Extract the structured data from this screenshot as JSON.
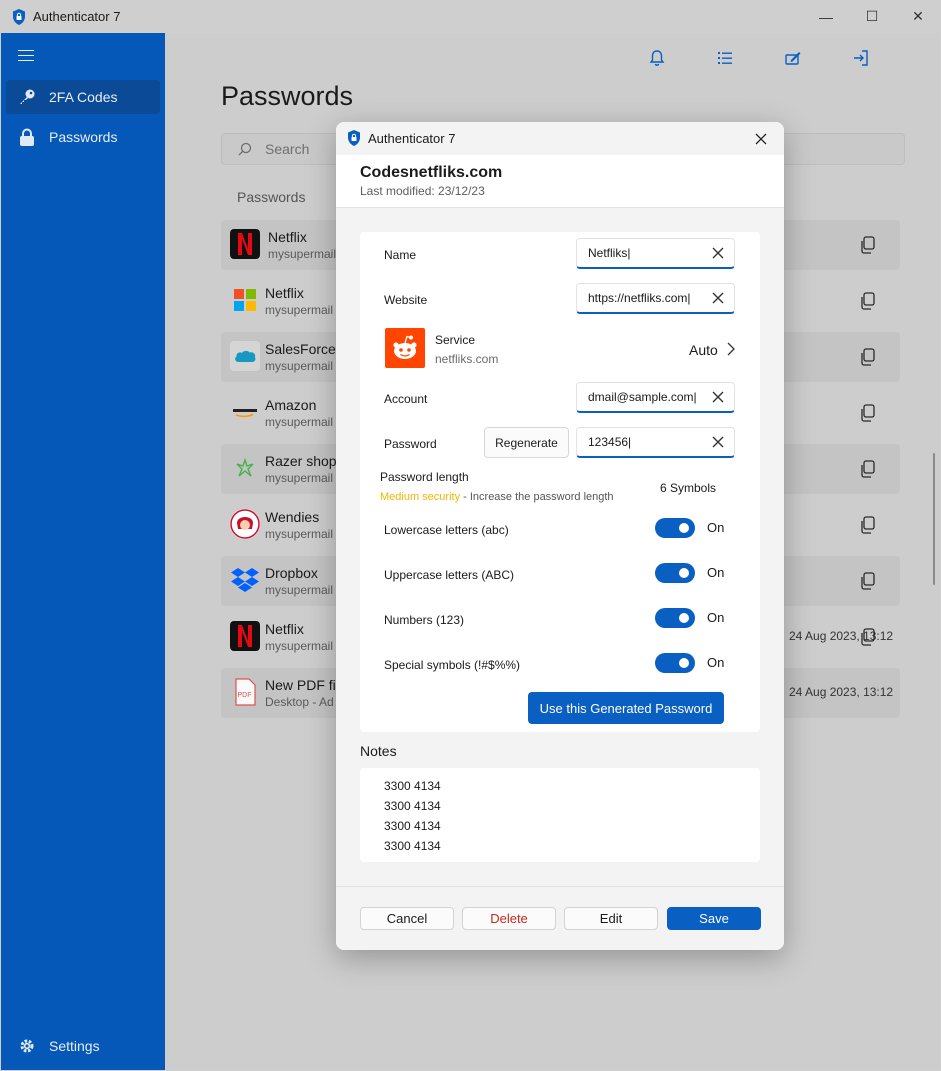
{
  "window": {
    "title": "Authenticator 7",
    "minimize": "—",
    "maximize": "☐",
    "close": "✕"
  },
  "sidebar": {
    "items": [
      {
        "label": "2FA Codes",
        "icon": "key-icon"
      },
      {
        "label": "Passwords",
        "icon": "lock-icon"
      }
    ],
    "settings_label": "Settings"
  },
  "main": {
    "title": "Passwords",
    "search_placeholder": "Search",
    "list_header": "Passwords",
    "rows": [
      {
        "name": "Netflix",
        "sub": "mysupermail",
        "date": ""
      },
      {
        "name": "Netflix",
        "sub": "mysupermail",
        "date": ""
      },
      {
        "name": "SalesForce",
        "sub": "mysupermail",
        "date": ""
      },
      {
        "name": "Amazon",
        "sub": "mysupermail",
        "date": ""
      },
      {
        "name": "Razer shop",
        "sub": "mysupermail",
        "date": ""
      },
      {
        "name": "Wendies",
        "sub": "mysupermail",
        "date": ""
      },
      {
        "name": "Dropbox",
        "sub": "mysupermail",
        "date": ""
      },
      {
        "name": "Netflix",
        "sub": "mysupermail",
        "date": "24 Aug 2023, 13:12"
      },
      {
        "name": "New PDF fil",
        "sub": "Desktop - Ad",
        "date": "24 Aug 2023, 13:12"
      }
    ]
  },
  "dialog": {
    "title": "Authenticator 7",
    "header_title": "Codesnetfliks.com",
    "header_sub": "Last modified: 23/12/23",
    "name_label": "Name",
    "name_value": "Netfliks|",
    "website_label": "Website",
    "website_value": "https://netfliks.com|",
    "service_label": "Service",
    "service_sub": "netfliks.com",
    "service_mode": "Auto",
    "account_label": "Account",
    "account_value": "dmail@sample.com|",
    "password_label": "Password",
    "regenerate_label": "Regenerate",
    "password_value": "123456|",
    "length_label": "Password length",
    "length_warn": "Medium security",
    "length_hint": " - Increase the password length",
    "length_value": "6 Symbols",
    "toggles": [
      {
        "label": "Lowercase letters (abc)",
        "state": "On",
        "on": true
      },
      {
        "label": "Uppercase letters (ABC)",
        "state": "On",
        "on": true
      },
      {
        "label": "Numbers (123)",
        "state": "On",
        "on": true
      },
      {
        "label": "Special symbols (!#$%%)",
        "state": "On",
        "on": true
      }
    ],
    "use_button": "Use this Generated Password",
    "notes_label": "Notes",
    "notes_lines": [
      "3300 4134",
      "3300 4134",
      "3300 4134",
      "3300 4134"
    ],
    "cancel_label": "Cancel",
    "delete_label": "Delete",
    "edit_label": "Edit",
    "save_label": "Save"
  },
  "colors": {
    "accent": "#0a5fc2",
    "sidebar": "#0557b8",
    "warning": "#f1b500",
    "danger": "#c42b1c",
    "reddit": "#ff4500"
  }
}
